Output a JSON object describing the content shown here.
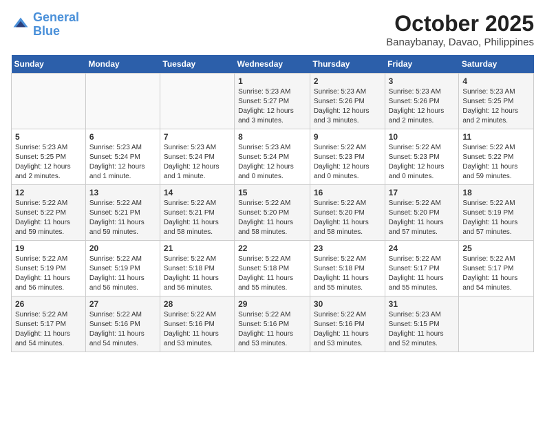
{
  "header": {
    "logo_line1": "General",
    "logo_line2": "Blue",
    "month": "October 2025",
    "location": "Banaybanay, Davao, Philippines"
  },
  "weekdays": [
    "Sunday",
    "Monday",
    "Tuesday",
    "Wednesday",
    "Thursday",
    "Friday",
    "Saturday"
  ],
  "weeks": [
    [
      {
        "day": "",
        "info": ""
      },
      {
        "day": "",
        "info": ""
      },
      {
        "day": "",
        "info": ""
      },
      {
        "day": "1",
        "info": "Sunrise: 5:23 AM\nSunset: 5:27 PM\nDaylight: 12 hours and 3 minutes."
      },
      {
        "day": "2",
        "info": "Sunrise: 5:23 AM\nSunset: 5:26 PM\nDaylight: 12 hours and 3 minutes."
      },
      {
        "day": "3",
        "info": "Sunrise: 5:23 AM\nSunset: 5:26 PM\nDaylight: 12 hours and 2 minutes."
      },
      {
        "day": "4",
        "info": "Sunrise: 5:23 AM\nSunset: 5:25 PM\nDaylight: 12 hours and 2 minutes."
      }
    ],
    [
      {
        "day": "5",
        "info": "Sunrise: 5:23 AM\nSunset: 5:25 PM\nDaylight: 12 hours and 2 minutes."
      },
      {
        "day": "6",
        "info": "Sunrise: 5:23 AM\nSunset: 5:24 PM\nDaylight: 12 hours and 1 minute."
      },
      {
        "day": "7",
        "info": "Sunrise: 5:23 AM\nSunset: 5:24 PM\nDaylight: 12 hours and 1 minute."
      },
      {
        "day": "8",
        "info": "Sunrise: 5:23 AM\nSunset: 5:24 PM\nDaylight: 12 hours and 0 minutes."
      },
      {
        "day": "9",
        "info": "Sunrise: 5:22 AM\nSunset: 5:23 PM\nDaylight: 12 hours and 0 minutes."
      },
      {
        "day": "10",
        "info": "Sunrise: 5:22 AM\nSunset: 5:23 PM\nDaylight: 12 hours and 0 minutes."
      },
      {
        "day": "11",
        "info": "Sunrise: 5:22 AM\nSunset: 5:22 PM\nDaylight: 11 hours and 59 minutes."
      }
    ],
    [
      {
        "day": "12",
        "info": "Sunrise: 5:22 AM\nSunset: 5:22 PM\nDaylight: 11 hours and 59 minutes."
      },
      {
        "day": "13",
        "info": "Sunrise: 5:22 AM\nSunset: 5:21 PM\nDaylight: 11 hours and 59 minutes."
      },
      {
        "day": "14",
        "info": "Sunrise: 5:22 AM\nSunset: 5:21 PM\nDaylight: 11 hours and 58 minutes."
      },
      {
        "day": "15",
        "info": "Sunrise: 5:22 AM\nSunset: 5:20 PM\nDaylight: 11 hours and 58 minutes."
      },
      {
        "day": "16",
        "info": "Sunrise: 5:22 AM\nSunset: 5:20 PM\nDaylight: 11 hours and 58 minutes."
      },
      {
        "day": "17",
        "info": "Sunrise: 5:22 AM\nSunset: 5:20 PM\nDaylight: 11 hours and 57 minutes."
      },
      {
        "day": "18",
        "info": "Sunrise: 5:22 AM\nSunset: 5:19 PM\nDaylight: 11 hours and 57 minutes."
      }
    ],
    [
      {
        "day": "19",
        "info": "Sunrise: 5:22 AM\nSunset: 5:19 PM\nDaylight: 11 hours and 56 minutes."
      },
      {
        "day": "20",
        "info": "Sunrise: 5:22 AM\nSunset: 5:19 PM\nDaylight: 11 hours and 56 minutes."
      },
      {
        "day": "21",
        "info": "Sunrise: 5:22 AM\nSunset: 5:18 PM\nDaylight: 11 hours and 56 minutes."
      },
      {
        "day": "22",
        "info": "Sunrise: 5:22 AM\nSunset: 5:18 PM\nDaylight: 11 hours and 55 minutes."
      },
      {
        "day": "23",
        "info": "Sunrise: 5:22 AM\nSunset: 5:18 PM\nDaylight: 11 hours and 55 minutes."
      },
      {
        "day": "24",
        "info": "Sunrise: 5:22 AM\nSunset: 5:17 PM\nDaylight: 11 hours and 55 minutes."
      },
      {
        "day": "25",
        "info": "Sunrise: 5:22 AM\nSunset: 5:17 PM\nDaylight: 11 hours and 54 minutes."
      }
    ],
    [
      {
        "day": "26",
        "info": "Sunrise: 5:22 AM\nSunset: 5:17 PM\nDaylight: 11 hours and 54 minutes."
      },
      {
        "day": "27",
        "info": "Sunrise: 5:22 AM\nSunset: 5:16 PM\nDaylight: 11 hours and 54 minutes."
      },
      {
        "day": "28",
        "info": "Sunrise: 5:22 AM\nSunset: 5:16 PM\nDaylight: 11 hours and 53 minutes."
      },
      {
        "day": "29",
        "info": "Sunrise: 5:22 AM\nSunset: 5:16 PM\nDaylight: 11 hours and 53 minutes."
      },
      {
        "day": "30",
        "info": "Sunrise: 5:22 AM\nSunset: 5:16 PM\nDaylight: 11 hours and 53 minutes."
      },
      {
        "day": "31",
        "info": "Sunrise: 5:23 AM\nSunset: 5:15 PM\nDaylight: 11 hours and 52 minutes."
      },
      {
        "day": "",
        "info": ""
      }
    ]
  ]
}
